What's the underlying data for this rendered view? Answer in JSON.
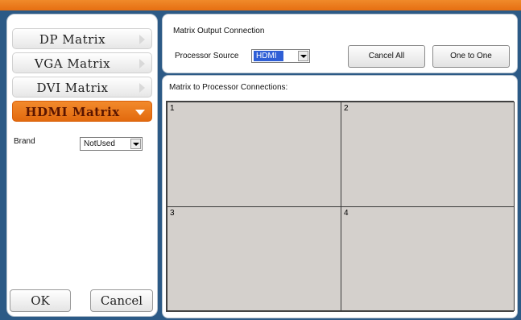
{
  "left_panel": {
    "matrix_buttons": [
      {
        "label": "DP Matrix"
      },
      {
        "label": "VGA Matrix"
      },
      {
        "label": "DVI Matrix"
      },
      {
        "label": "HDMI Matrix",
        "active": true
      }
    ],
    "brand": {
      "label": "Brand",
      "value": "NotUsed"
    },
    "ok_label": "OK",
    "cancel_label": "Cancel"
  },
  "output_connection": {
    "title": "Matrix Output Connection",
    "processor_source_label": "Processor Source",
    "processor_source_value": "HDMI",
    "cancel_all_label": "Cancel All",
    "one_to_one_label": "One to One"
  },
  "connections": {
    "title": "Matrix to Processor Connections:",
    "cells": [
      "1",
      "2",
      "3",
      "4"
    ]
  },
  "colors": {
    "accent_orange": "#e66f12",
    "background_blue": "#2c5a86",
    "selected_blue": "#2f5fd6",
    "cell_gray": "#d4d0cc"
  }
}
